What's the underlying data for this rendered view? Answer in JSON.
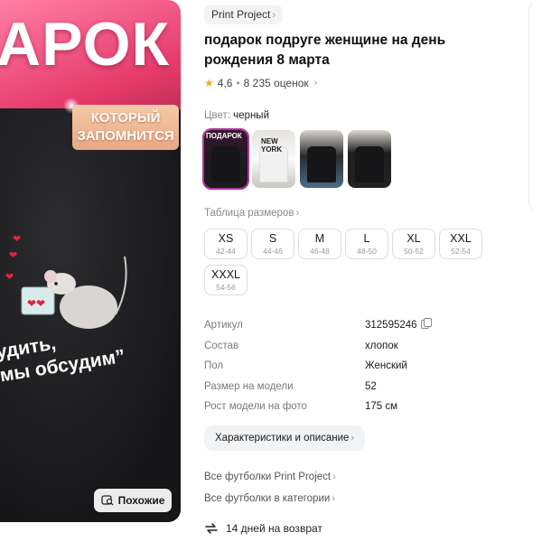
{
  "hero": {
    "big_word": "АРОК",
    "badge_line1": "КОТОРЫЙ",
    "badge_line2": "ЗАПОМНИТСЯ",
    "quote_line1": "удить,",
    "quote_line2": "мы обсудим”",
    "similar_label": "Похожие"
  },
  "brand": "Print Project",
  "title": "подарок подруге женщине на день рождения 8 марта",
  "rating": {
    "value": "4,6",
    "reviews": "8 235 оценок"
  },
  "color": {
    "label": "Цвет:",
    "value": "черный"
  },
  "swatches": [
    {
      "text": "ПОДАРОК"
    },
    {
      "text": "NEW YORK"
    },
    {
      "text": ""
    },
    {
      "text": ""
    }
  ],
  "size_table_label": "Таблица размеров",
  "sizes": [
    {
      "size": "XS",
      "range": "42-44"
    },
    {
      "size": "S",
      "range": "44-46"
    },
    {
      "size": "M",
      "range": "46-48"
    },
    {
      "size": "L",
      "range": "48-50"
    },
    {
      "size": "XL",
      "range": "50-52"
    },
    {
      "size": "XXL",
      "range": "52-54"
    },
    {
      "size": "XXXL",
      "range": "54-56"
    }
  ],
  "specs": [
    {
      "key": "Артикул",
      "value": "312595246"
    },
    {
      "key": "Состав",
      "value": "хлопок"
    },
    {
      "key": "Пол",
      "value": "Женский"
    },
    {
      "key": "Размер на модели",
      "value": "52"
    },
    {
      "key": "Рост модели на фото",
      "value": "175 см"
    }
  ],
  "characteristics_button": "Характеристики и описание",
  "links": {
    "all_brand": "Все футболки Print Project",
    "all_category": "Все футболки в категории"
  },
  "return_text": "14 дней на возврат",
  "colors": {
    "accent": "#b035a0",
    "star": "#f5a623"
  }
}
